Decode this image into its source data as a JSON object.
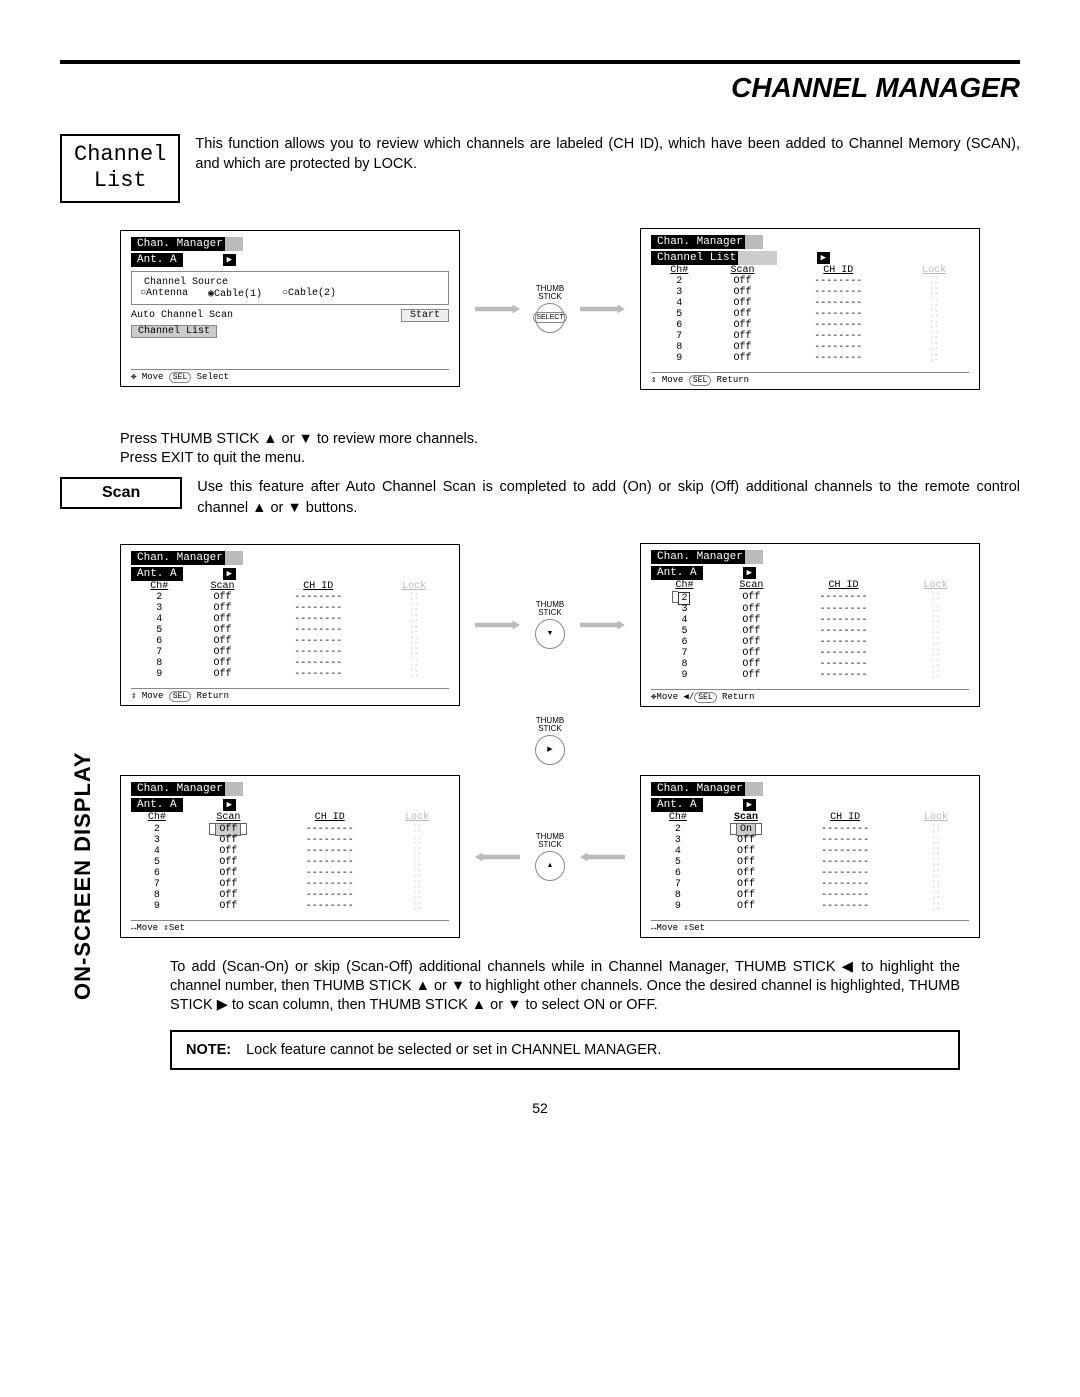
{
  "header": {
    "title": "CHANNEL MANAGER"
  },
  "channel_list": {
    "label": "Channel\nList",
    "text": "This function allows you to review which channels are labeled (CH ID), which have been added to Channel Memory (SCAN), and which are protected by LOCK."
  },
  "panel1": {
    "tab": "Chan. Manager",
    "subtab": "Ant. A",
    "fieldset_title": "Channel Source",
    "radios": [
      "○Antenna",
      "◉Cable(1)",
      "○Cable(2)"
    ],
    "auto_scan_label": "Auto Channel Scan",
    "start_btn": "Start",
    "channel_list_btn": "Channel List",
    "footer_move": "✥ Move",
    "footer_sel": "SEL",
    "footer_select": "Select"
  },
  "thumbstick_label": "THUMB\nSTICK",
  "thumbstick_select": "SELECT",
  "panel2": {
    "tab": "Chan. Manager",
    "subtab_sel": "Channel List",
    "headers": [
      "Ch#",
      "Scan",
      "CH ID",
      "Lock"
    ],
    "rows": [
      {
        "ch": "2",
        "scan": "Off",
        "id": "--------"
      },
      {
        "ch": "3",
        "scan": "Off",
        "id": "--------"
      },
      {
        "ch": "4",
        "scan": "Off",
        "id": "--------"
      },
      {
        "ch": "5",
        "scan": "Off",
        "id": "--------"
      },
      {
        "ch": "6",
        "scan": "Off",
        "id": "--------"
      },
      {
        "ch": "7",
        "scan": "Off",
        "id": "--------"
      },
      {
        "ch": "8",
        "scan": "Off",
        "id": "--------"
      },
      {
        "ch": "9",
        "scan": "Off",
        "id": "--------"
      }
    ],
    "footer_move": "⇕ Move",
    "footer_sel": "SEL",
    "footer_return": "Return"
  },
  "mid_text": "Press THUMB STICK ▲ or ▼ to review more channels.\nPress EXIT to quit the menu.",
  "scan_section": {
    "label": "Scan",
    "text": "Use this feature after Auto Channel Scan is completed to add (On) or skip (Off) additional channels to the remote control channel ▲ or ▼ buttons."
  },
  "panel_a": {
    "tab": "Chan. Manager",
    "subtab": "Ant. A",
    "headers": [
      "Ch#",
      "Scan",
      "CH ID",
      "Lock"
    ],
    "rows": [
      {
        "ch": "2",
        "scan": "Off",
        "id": "--------"
      },
      {
        "ch": "3",
        "scan": "Off",
        "id": "--------"
      },
      {
        "ch": "4",
        "scan": "Off",
        "id": "--------"
      },
      {
        "ch": "5",
        "scan": "Off",
        "id": "--------"
      },
      {
        "ch": "6",
        "scan": "Off",
        "id": "--------"
      },
      {
        "ch": "7",
        "scan": "Off",
        "id": "--------"
      },
      {
        "ch": "8",
        "scan": "Off",
        "id": "--------"
      },
      {
        "ch": "9",
        "scan": "Off",
        "id": "--------"
      }
    ],
    "footer": "⇕ Move  SEL Return"
  },
  "panel_b": {
    "tab": "Chan. Manager",
    "subtab": "Ant. A",
    "headers": [
      "Ch#",
      "Scan",
      "CH ID",
      "Lock"
    ],
    "highlight_row": 0,
    "rows": [
      {
        "ch": "2",
        "scan": "Off",
        "id": "--------"
      },
      {
        "ch": "3",
        "scan": "Off",
        "id": "--------"
      },
      {
        "ch": "4",
        "scan": "Off",
        "id": "--------"
      },
      {
        "ch": "5",
        "scan": "Off",
        "id": "--------"
      },
      {
        "ch": "6",
        "scan": "Off",
        "id": "--------"
      },
      {
        "ch": "7",
        "scan": "Off",
        "id": "--------"
      },
      {
        "ch": "8",
        "scan": "Off",
        "id": "--------"
      },
      {
        "ch": "9",
        "scan": "Off",
        "id": "--------"
      }
    ],
    "footer": "✥Move   ◀/SEL Return"
  },
  "panel_c": {
    "tab": "Chan. Manager",
    "subtab": "Ant. A",
    "headers": [
      "Ch#",
      "Scan",
      "CH ID",
      "Lock"
    ],
    "highlight_scan_row": 0,
    "rows": [
      {
        "ch": "2",
        "scan": "Off",
        "id": "--------"
      },
      {
        "ch": "3",
        "scan": "Off",
        "id": "--------"
      },
      {
        "ch": "4",
        "scan": "Off",
        "id": "--------"
      },
      {
        "ch": "5",
        "scan": "Off",
        "id": "--------"
      },
      {
        "ch": "6",
        "scan": "Off",
        "id": "--------"
      },
      {
        "ch": "7",
        "scan": "Off",
        "id": "--------"
      },
      {
        "ch": "8",
        "scan": "Off",
        "id": "--------"
      },
      {
        "ch": "9",
        "scan": "Off",
        "id": "--------"
      }
    ],
    "footer": "↔Move   ⇕Set"
  },
  "panel_d": {
    "tab": "Chan. Manager",
    "subtab": "Ant. A",
    "headers": [
      "Ch#",
      "Scan",
      "CH ID",
      "Lock"
    ],
    "highlight_scan_row": 0,
    "scan_underline": true,
    "rows": [
      {
        "ch": "2",
        "scan": "On",
        "id": "--------"
      },
      {
        "ch": "3",
        "scan": "Off",
        "id": "--------"
      },
      {
        "ch": "4",
        "scan": "Off",
        "id": "--------"
      },
      {
        "ch": "5",
        "scan": "Off",
        "id": "--------"
      },
      {
        "ch": "6",
        "scan": "Off",
        "id": "--------"
      },
      {
        "ch": "7",
        "scan": "Off",
        "id": "--------"
      },
      {
        "ch": "8",
        "scan": "Off",
        "id": "--------"
      },
      {
        "ch": "9",
        "scan": "Off",
        "id": "--------"
      }
    ],
    "footer": "↔Move   ⇕Set"
  },
  "bottom_text": "To add (Scan-On) or skip (Scan-Off) additional channels while in Channel Manager, THUMB STICK ◀ to highlight the channel number, then THUMB STICK ▲ or ▼ to highlight other channels.  Once the desired channel is highlighted, THUMB STICK ▶ to scan column, then THUMB STICK ▲ or ▼ to select ON or OFF.",
  "note": {
    "label": "NOTE:",
    "text": "Lock feature cannot be selected or set in CHANNEL MANAGER."
  },
  "side_label": "ON-SCREEN DISPLAY",
  "page_number": "52"
}
